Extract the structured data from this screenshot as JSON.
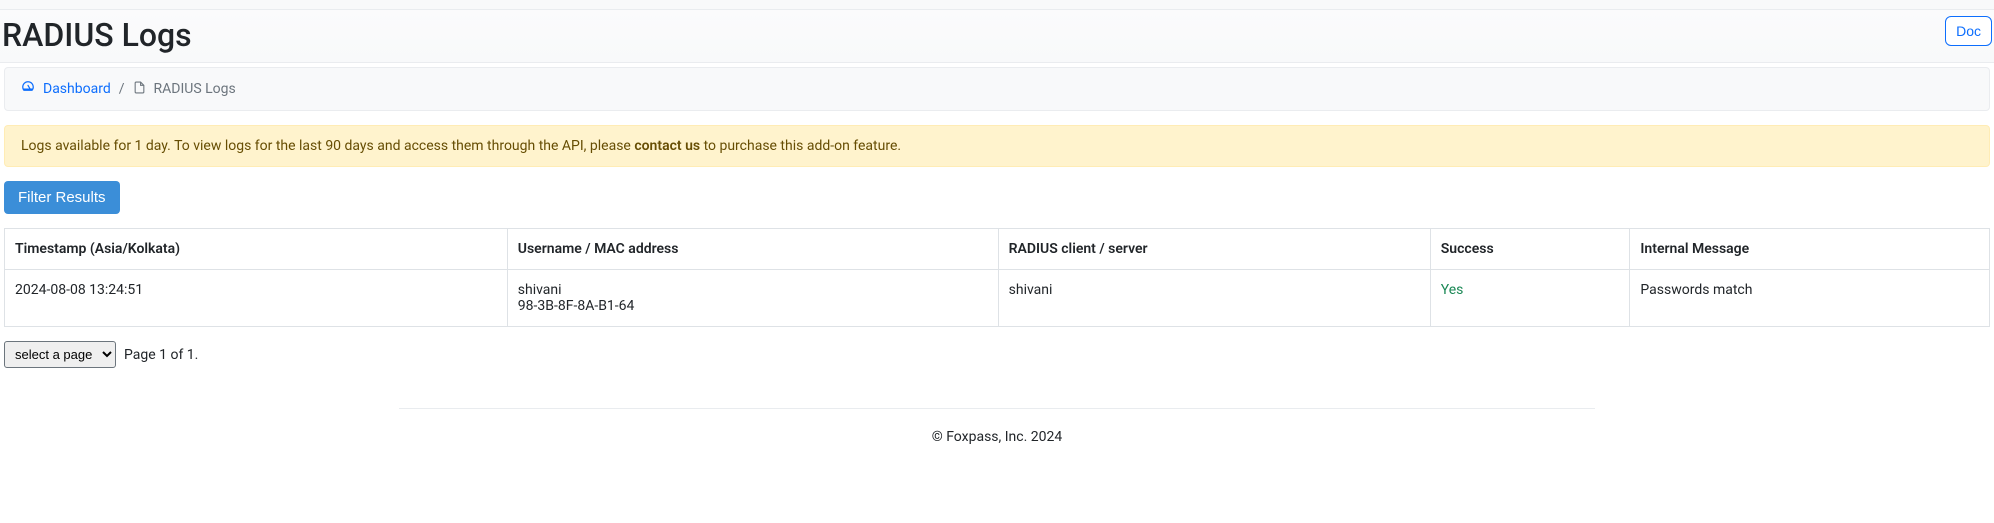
{
  "header": {
    "title": "RADIUS Logs",
    "doc_button": "Doc"
  },
  "breadcrumb": {
    "dashboard": "Dashboard",
    "current": "RADIUS Logs"
  },
  "alert": {
    "prefix": "Logs available for 1 day. To view logs for the last 90 days and access them through the API, please ",
    "link": "contact us",
    "suffix": " to purchase this add-on feature."
  },
  "filter_button": "Filter Results",
  "table": {
    "headers": {
      "timestamp": "Timestamp (Asia/Kolkata)",
      "username": "Username / MAC address",
      "client": "RADIUS client / server",
      "success": "Success",
      "message": "Internal Message"
    },
    "rows": [
      {
        "timestamp": "2024-08-08 13:24:51",
        "username": "shivani",
        "mac": "98-3B-8F-8A-B1-64",
        "client": "shivani",
        "success": "Yes",
        "message": "Passwords match"
      }
    ]
  },
  "pager": {
    "select_placeholder": "select a page",
    "label": "Page 1 of 1."
  },
  "footer": "© Foxpass, Inc. 2024"
}
